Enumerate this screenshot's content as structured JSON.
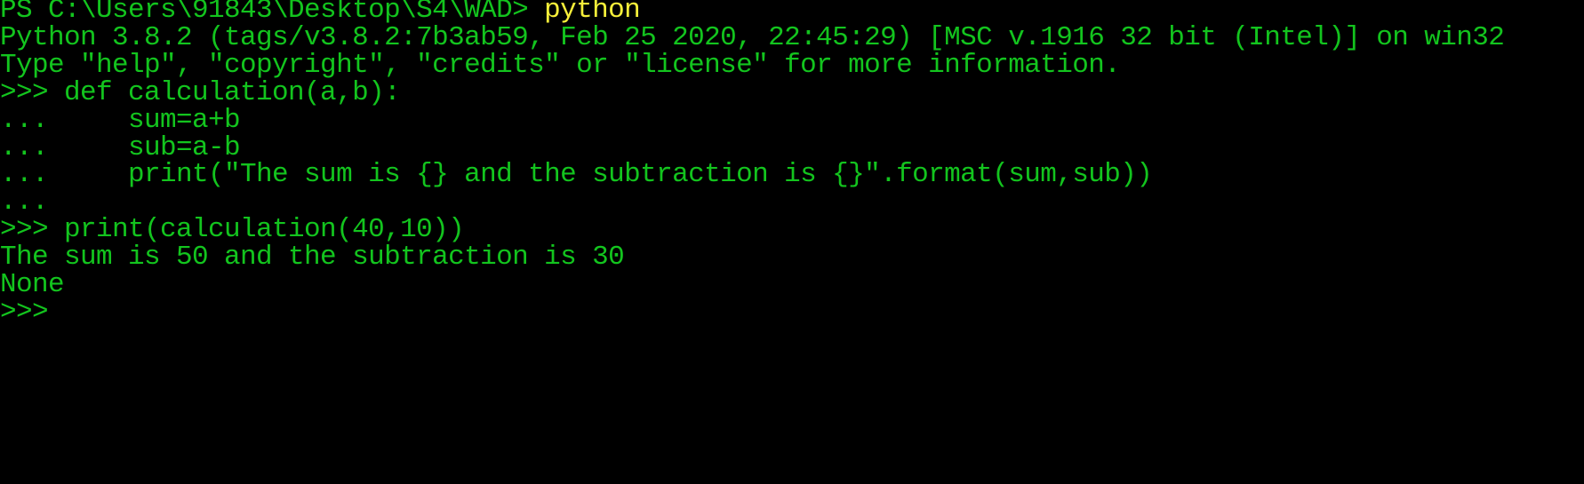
{
  "colors": {
    "background": "#000000",
    "text": "#13c41e",
    "command": "#f7ef3a"
  },
  "terminal": {
    "ps_prompt": "PS C:\\Users\\91843\\Desktop\\S4\\WAD> ",
    "ps_command": "python",
    "lines": [
      "Python 3.8.2 (tags/v3.8.2:7b3ab59, Feb 25 2020, 22:45:29) [MSC v.1916 32 bit (Intel)] on win32",
      "Type \"help\", \"copyright\", \"credits\" or \"license\" for more information.",
      ">>> def calculation(a,b):",
      "...     sum=a+b",
      "...     sub=a-b",
      "...     print(\"The sum is {} and the subtraction is {}\".format(sum,sub))",
      "...",
      ">>> print(calculation(40,10))",
      "The sum is 50 and the subtraction is 30",
      "None",
      ">>>"
    ]
  }
}
